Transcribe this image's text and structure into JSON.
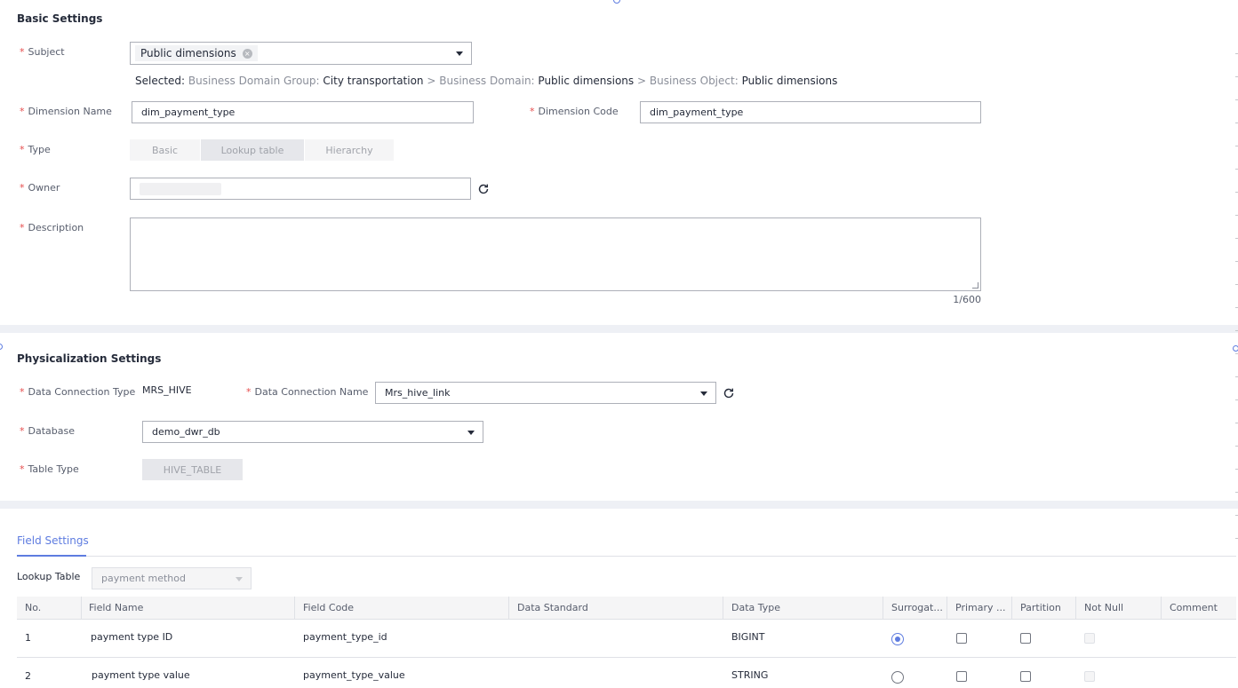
{
  "basic": {
    "title": "Basic Settings",
    "subject": {
      "label": "Subject",
      "tag": "Public dimensions"
    },
    "selected": {
      "prefix": "Selected:",
      "group_label": "Business Domain Group:",
      "group_value": "City transportation",
      "domain_label": "Business Domain:",
      "domain_value": "Public dimensions",
      "object_label": "Business Object:",
      "object_value": "Public dimensions",
      "sep": ">"
    },
    "dimension_name": {
      "label": "Dimension Name",
      "value": "dim_payment_type"
    },
    "dimension_code": {
      "label": "Dimension Code",
      "value": "dim_payment_type"
    },
    "type": {
      "label": "Type",
      "options": [
        "Basic",
        "Lookup table",
        "Hierarchy"
      ]
    },
    "owner": {
      "label": "Owner",
      "value": ""
    },
    "description": {
      "label": "Description",
      "value": "",
      "counter": "1/600"
    }
  },
  "phys": {
    "title": "Physicalization Settings",
    "conn_type": {
      "label": "Data Connection Type",
      "value": "MRS_HIVE"
    },
    "conn_name": {
      "label": "Data Connection Name",
      "value": "Mrs_hive_link"
    },
    "database": {
      "label": "Database",
      "value": "demo_dwr_db"
    },
    "table_type": {
      "label": "Table Type",
      "value": "HIVE_TABLE"
    }
  },
  "fields": {
    "tab": "Field Settings",
    "lookup": {
      "label": "Lookup Table",
      "value": "payment method"
    },
    "columns": [
      "No.",
      "Field Name",
      "Field Code",
      "Data Standard",
      "Data Type",
      "Surrogat...",
      "Primary ...",
      "Partition",
      "Not Null",
      "Comment"
    ],
    "rows": [
      {
        "no": "1",
        "name": "payment type ID",
        "code": "payment_type_id",
        "standard": "",
        "type": "BIGINT",
        "surrogate": true
      },
      {
        "no": "2",
        "name": "payment type value",
        "code": "payment_type_value",
        "standard": "",
        "type": "STRING",
        "surrogate": false
      }
    ]
  },
  "colors": {
    "accent": "#5e7ce0",
    "required": "#e64c4c",
    "band": "#eef0f5"
  }
}
